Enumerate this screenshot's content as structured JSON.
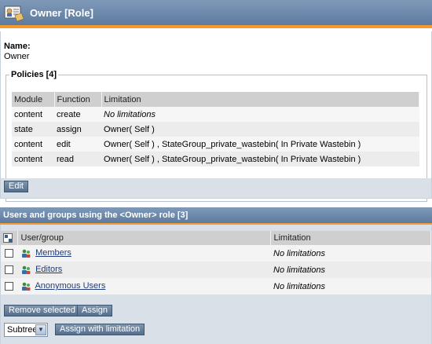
{
  "role_panel": {
    "title": "Owner [Role]",
    "name_label": "Name:",
    "name_value": "Owner",
    "policies_legend": "Policies [4]",
    "columns": [
      "Module",
      "Function",
      "Limitation"
    ],
    "policies": [
      {
        "module": "content",
        "function": "create",
        "limitation": "No limitations"
      },
      {
        "module": "state",
        "function": "assign",
        "limitation": "Owner( Self )"
      },
      {
        "module": "content",
        "function": "edit",
        "limitation": "Owner( Self ) , StateGroup_private_wastebin( In Private Wastebin )"
      },
      {
        "module": "content",
        "function": "read",
        "limitation": "Owner( Self ) , StateGroup_private_wastebin( In Private Wastebin )"
      }
    ],
    "edit_button": "Edit"
  },
  "users_panel": {
    "title": "Users and groups using the <Owner> role [3]",
    "columns": [
      "User/group",
      "Limitation"
    ],
    "rows": [
      {
        "name": "Members",
        "limitation": "No limitations"
      },
      {
        "name": "Editors",
        "limitation": "No limitations"
      },
      {
        "name": "Anonymous Users",
        "limitation": "No limitations"
      }
    ],
    "remove_button": "Remove selected",
    "assign_button": "Assign",
    "subtree_select": "Subtree",
    "assign_limitation_button": "Assign with limitation"
  },
  "colors": {
    "header_blue": "#6a86aa",
    "accent_orange": "#f29a2e",
    "button_blue": "#607896"
  },
  "icons": {
    "role": "role-card-icon",
    "group": "user-group-icon",
    "invert": "invert-selection-icon"
  }
}
